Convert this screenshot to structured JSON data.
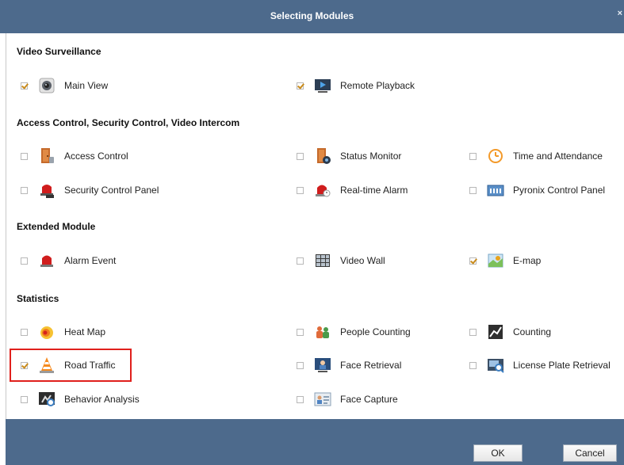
{
  "dialog": {
    "title": "Selecting Modules",
    "close_symbol": "×"
  },
  "sections": [
    {
      "title": "Video Surveillance",
      "items": [
        {
          "label": "Main View",
          "checked": true,
          "icon": "camera-icon"
        },
        {
          "label": "Remote Playback",
          "checked": true,
          "icon": "playback-icon"
        }
      ]
    },
    {
      "title": "Access Control, Security Control, Video Intercom",
      "items": [
        {
          "label": "Access Control",
          "checked": false,
          "icon": "door-icon"
        },
        {
          "label": "Status Monitor",
          "checked": false,
          "icon": "door-status-icon"
        },
        {
          "label": "Time and Attendance",
          "checked": false,
          "icon": "clock-icon"
        },
        {
          "label": "Security Control Panel",
          "checked": false,
          "icon": "siren-panel-icon"
        },
        {
          "label": "Real-time Alarm",
          "checked": false,
          "icon": "alarm-icon"
        },
        {
          "label": "Pyronix Control Panel",
          "checked": false,
          "icon": "control-panel-icon"
        }
      ]
    },
    {
      "title": "Extended Module",
      "items": [
        {
          "label": "Alarm Event",
          "checked": false,
          "icon": "siren-icon"
        },
        {
          "label": "Video Wall",
          "checked": false,
          "icon": "video-wall-icon"
        },
        {
          "label": "E-map",
          "checked": true,
          "icon": "emap-icon"
        }
      ]
    },
    {
      "title": "Statistics",
      "items": [
        {
          "label": "Heat Map",
          "checked": false,
          "icon": "heat-map-icon"
        },
        {
          "label": "People Counting",
          "checked": false,
          "icon": "people-counting-icon"
        },
        {
          "label": "Counting",
          "checked": false,
          "icon": "counting-icon"
        },
        {
          "label": "Road Traffic",
          "checked": true,
          "icon": "traffic-cone-icon"
        },
        {
          "label": "Face Retrieval",
          "checked": false,
          "icon": "face-retrieval-icon"
        },
        {
          "label": "License Plate Retrieval",
          "checked": false,
          "icon": "license-plate-icon"
        },
        {
          "label": "Behavior Analysis",
          "checked": false,
          "icon": "behavior-analysis-icon"
        },
        {
          "label": "Face Capture",
          "checked": false,
          "icon": "face-capture-icon"
        }
      ]
    }
  ],
  "buttons": {
    "ok": "OK",
    "cancel": "Cancel"
  },
  "colors": {
    "titlebar": "#4d6a8c",
    "highlight": "#e0201c",
    "checkmark": "#c98b1c"
  }
}
